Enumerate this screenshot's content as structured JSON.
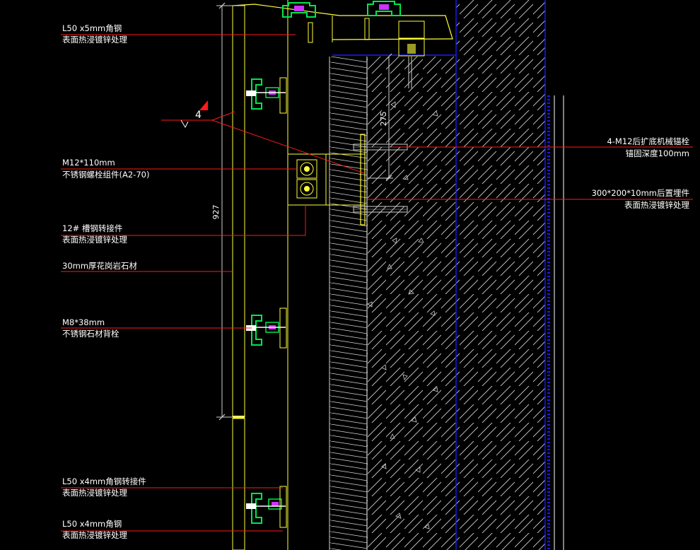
{
  "annotations": {
    "angle_steel_top": {
      "line1": "L50 x5mm角钢",
      "line2": "表面热浸镀锌处理"
    },
    "m12_bolt": {
      "line1": "M12*110mm",
      "line2": "不锈钢螺栓组件(A2-70)"
    },
    "channel_connector": {
      "line1": "12# 槽钢转接件",
      "line2": "表面热浸镀锌处理"
    },
    "granite": {
      "line1": "30mm厚花岗岩石材"
    },
    "m8_bolt": {
      "line1": "M8*38mm",
      "line2": "不锈钢石材背栓"
    },
    "angle_connector": {
      "line1": "L50 x4mm角钢转接件",
      "line2": "表面热浸镀锌处理"
    },
    "angle_steel_bottom": {
      "line1": "L50 x4mm角钢",
      "line2": "表面热浸镀锌处理"
    },
    "anchor_bolt": {
      "line1": "4-M12后扩底机械锚栓",
      "line2": "锚固深度100mm"
    },
    "embed_plate": {
      "line1": "300*200*10mm后置埋件",
      "line2": "表面热浸镀锌处理"
    }
  },
  "dimensions": {
    "panel_height": "927",
    "anchor_spacing": "275"
  },
  "weld_mark": "4",
  "colors": {
    "background": "#000000",
    "leader": "#ff1a1a",
    "structure": "#ffff3c",
    "bracket": "#00e64d",
    "bolt": "#cc33ff",
    "boundary": "#1a1aff",
    "hatch": "#cfcfcf"
  }
}
